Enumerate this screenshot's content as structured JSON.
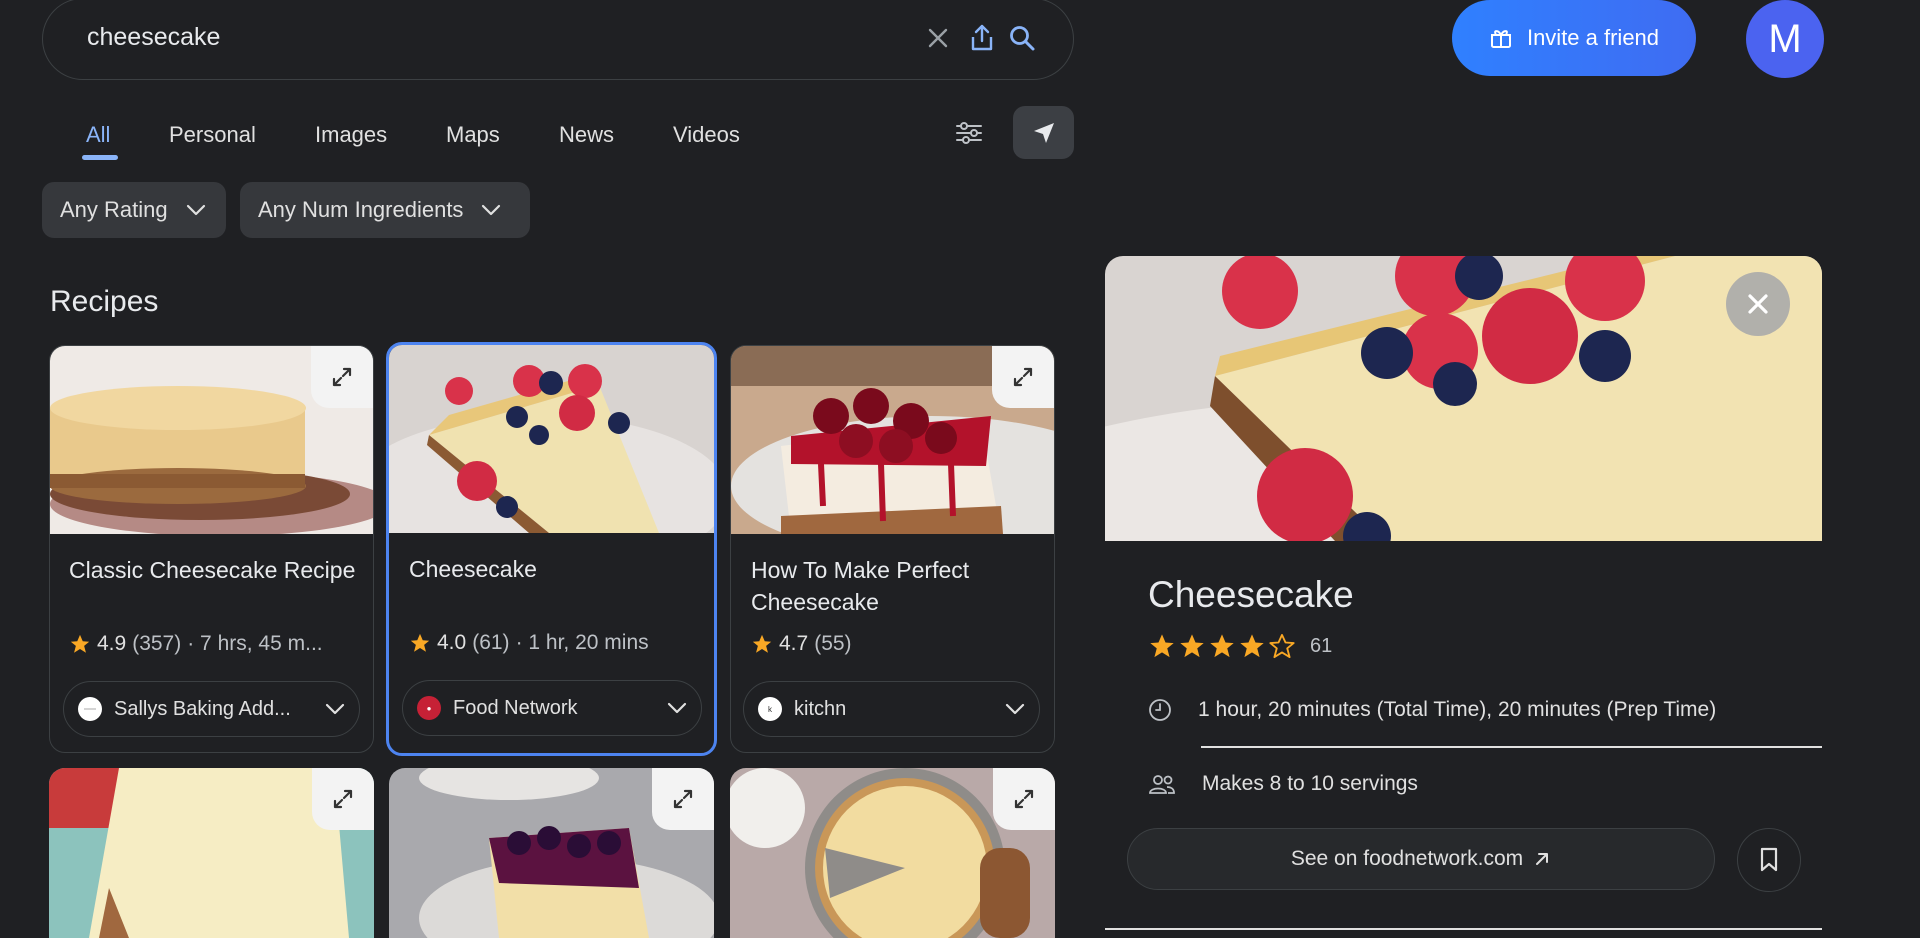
{
  "search": {
    "query": "cheesecake",
    "clear_icon": "close-icon",
    "share_icon": "share-icon",
    "search_icon": "search-icon"
  },
  "header": {
    "invite_label": "Invite a friend",
    "avatar_letter": "M"
  },
  "tabs": [
    {
      "label": "All",
      "active": true
    },
    {
      "label": "Personal"
    },
    {
      "label": "Images"
    },
    {
      "label": "Maps"
    },
    {
      "label": "News"
    },
    {
      "label": "Videos"
    }
  ],
  "filters": [
    {
      "label": "Any Rating"
    },
    {
      "label": "Any Num Ingredients"
    }
  ],
  "section_title": "Recipes",
  "recipes": [
    {
      "title": "Classic Cheesecake Recipe",
      "rating": "4.9",
      "count": "(357)",
      "time": "· 7 hrs, 45 m...",
      "source": "Sallys Baking Add..."
    },
    {
      "title": "Cheesecake",
      "rating": "4.0",
      "count": "(61)",
      "time": "· 1 hr, 20 mins",
      "source": "Food Network",
      "selected": true
    },
    {
      "title": "How To Make Perfect Cheesecake",
      "rating": "4.7",
      "count": "(55)",
      "time": "",
      "source": "kitchn"
    }
  ],
  "detail": {
    "title": "Cheesecake",
    "stars": 4,
    "rating_count": "61",
    "time_text": "1 hour, 20 minutes (Total Time), 20 minutes (Prep Time)",
    "servings_text": "Makes 8 to 10 servings",
    "see_on_label": "See on foodnetwork.com"
  },
  "colors": {
    "accent": "#8ab4f8",
    "star": "#f9a825",
    "background": "#1f2023"
  }
}
